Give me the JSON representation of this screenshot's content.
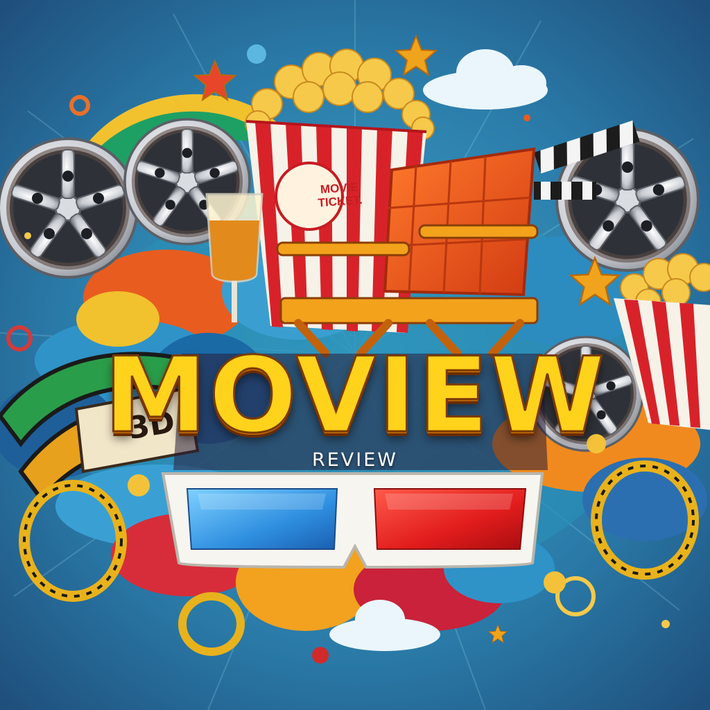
{
  "logo": {
    "title": "MOVIEW",
    "subtitle": "REVIEW",
    "sign_text": "3D",
    "ticket_lines": [
      "MOVIE",
      "TICKET."
    ]
  },
  "colors": {
    "background": "#2a6f9c",
    "title_yellow": "#ffd21c",
    "lens_blue": "#2f8fe0",
    "lens_red": "#e11c1c",
    "popcorn_stripe_red": "#d8222a",
    "chair_orange": "#e8551c"
  },
  "icons": [
    "film-reel-icon",
    "popcorn-bucket-icon",
    "directors-chair-icon",
    "clapperboard-icon",
    "3d-glasses-icon",
    "film-strip-icon",
    "star-icon",
    "cloud-icon",
    "wine-glass-icon"
  ]
}
